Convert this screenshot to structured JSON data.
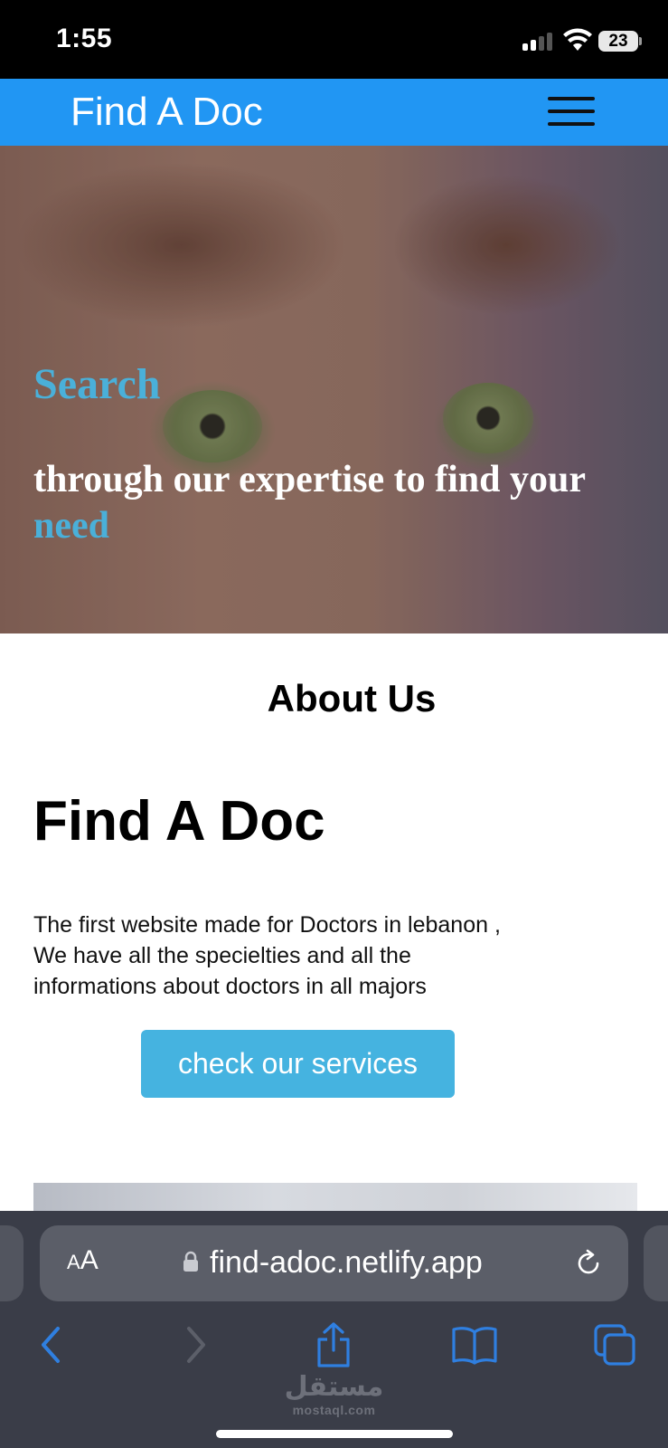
{
  "status_bar": {
    "time": "1:55",
    "battery": "23"
  },
  "site": {
    "logo": "Find A Doc"
  },
  "hero": {
    "search": "Search",
    "line": "through our expertise to find your",
    "need": "need"
  },
  "about": {
    "title": "About Us",
    "brand": "Find A Doc",
    "description": "The first website made for Doctors in lebanon , We have all the specielties and all the informations about doctors in all majors",
    "cta": "check our services"
  },
  "browser": {
    "aa_small": "A",
    "aa_large": "A",
    "url": "find-adoc.netlify.app"
  },
  "watermark": {
    "arabic": "مستقل",
    "latin": "mostaql.com"
  },
  "colors": {
    "header": "#2196f3",
    "accent": "#45b3e0",
    "hero_highlight": "#4ab0d9",
    "browser_chrome": "#3a3d48",
    "toolbar_icon": "#2f7fe0"
  }
}
